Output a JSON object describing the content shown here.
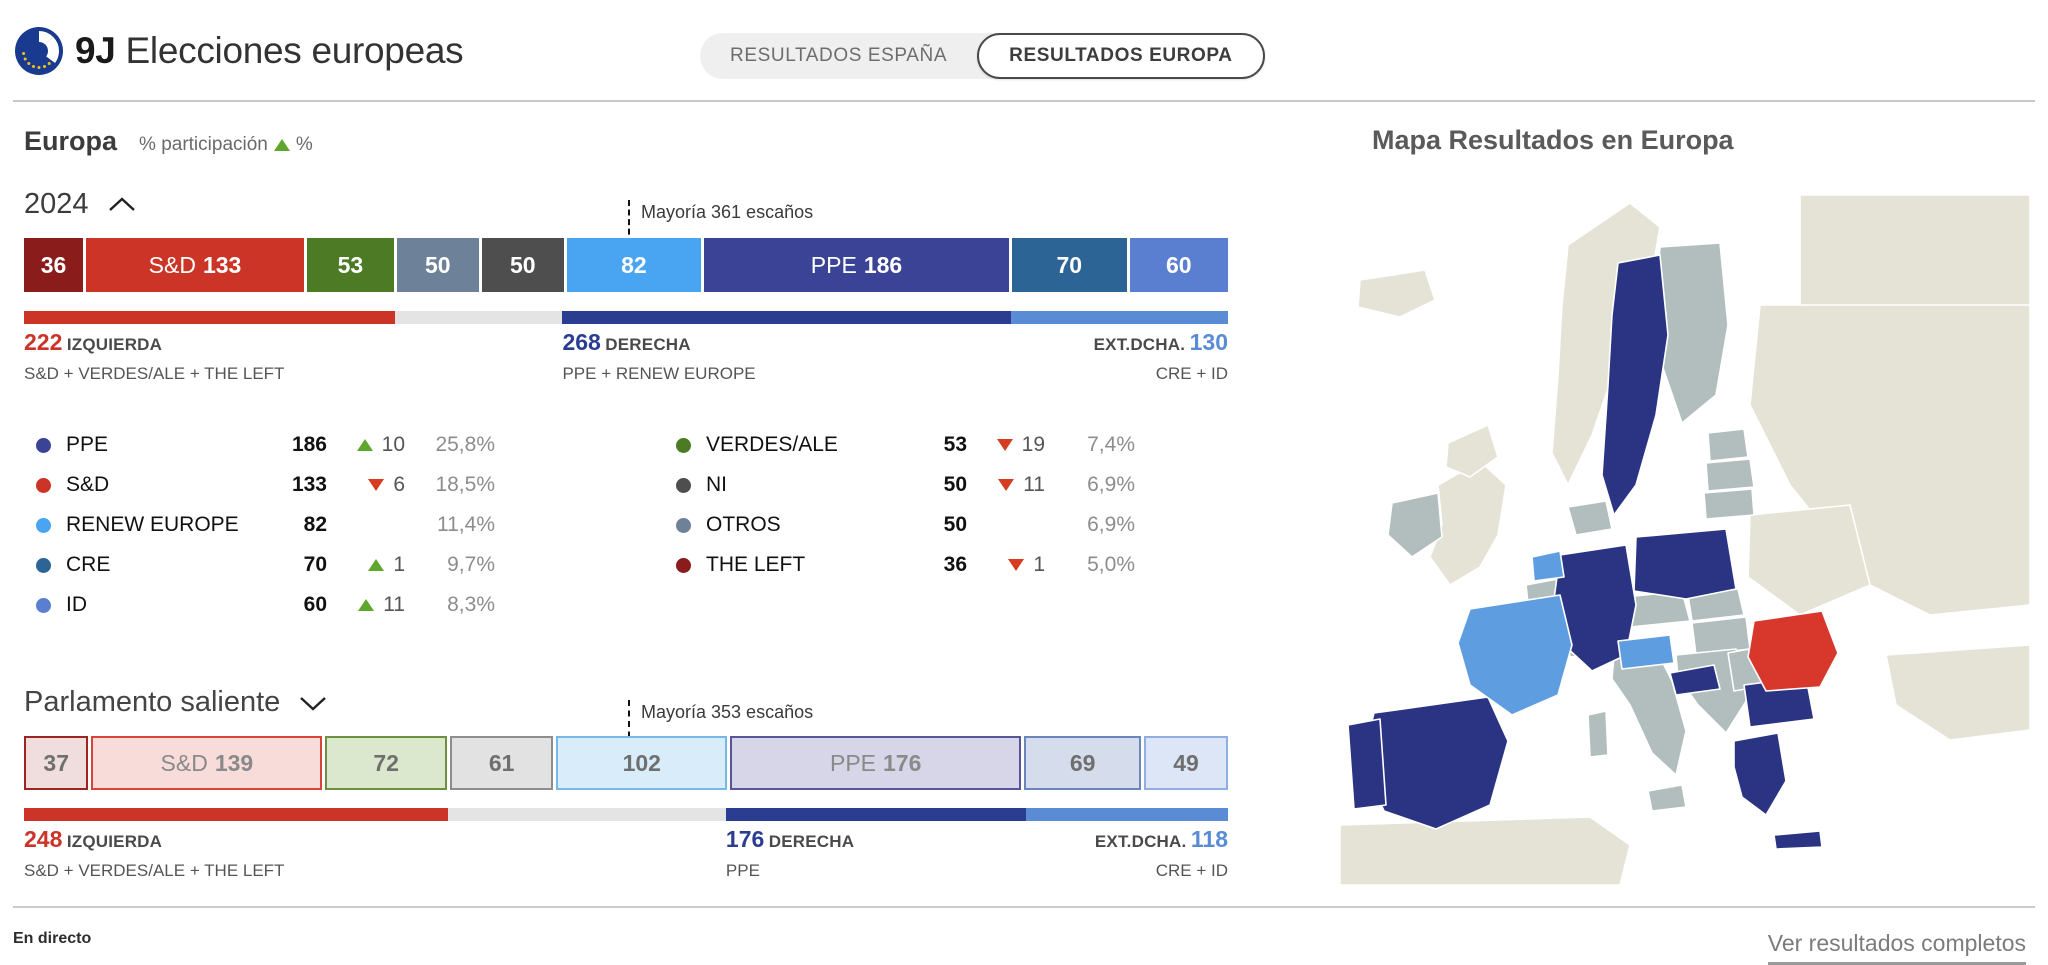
{
  "header": {
    "logo_icon": "eu-flag-icon",
    "title_bold": "9J",
    "title_rest": "Elecciones europeas",
    "toggle": {
      "spain_label": "RESULTADOS ESPAÑA",
      "europe_label": "RESULTADOS EUROPA",
      "active": "RESULTADOS EUROPA"
    }
  },
  "section": {
    "title": "Europa",
    "participacion": "% participación",
    "participacion_trend_icon": "triangle-up-icon",
    "participacion_value": "%"
  },
  "map": {
    "title": "Mapa Resultados en Europa"
  },
  "footer": {
    "live_label": "En directo",
    "see_all_label": "Ver resultados completos"
  },
  "colors": {
    "ppe": "#3a4395",
    "sd": "#cb3427",
    "renew": "#49a5f2",
    "cre": "#2c6496",
    "id": "#5a7fd0",
    "verdes": "#4d7a25",
    "ni": "#4e4e4e",
    "otros": "#6d8198",
    "left": "#8a1c1c",
    "izquierda": "#cb3427",
    "derecha": "#3a4395",
    "extdcha": "#5a8cd6",
    "up": "#5ea72c",
    "down": "#d43d21",
    "track": "#e4e4e4"
  },
  "chart_data": [
    {
      "type": "bar",
      "id": "resultados-2024",
      "title": "2024",
      "collapse_icon": "chevron-up-icon",
      "total_seats": 720,
      "majority_label": "Mayoría 361 escaños",
      "majority_seats": 361,
      "categories": [
        "THE LEFT",
        "S&D",
        "VERDES/ALE",
        "OTROS",
        "NI",
        "RENEW EUROPE",
        "PPE",
        "CRE",
        "ID"
      ],
      "values": [
        36,
        133,
        53,
        50,
        50,
        82,
        186,
        70,
        60
      ],
      "segments": [
        {
          "key": "left",
          "label": "",
          "value": "36",
          "color": "#8a1c1c",
          "text_color": "#ffffff"
        },
        {
          "key": "sd",
          "label": "S&D",
          "value": "133",
          "color": "#cb3427",
          "text_color": "#ffffff"
        },
        {
          "key": "verdes",
          "label": "",
          "value": "53",
          "color": "#4d7a25",
          "text_color": "#ffffff"
        },
        {
          "key": "otros",
          "label": "",
          "value": "50",
          "color": "#6d8198",
          "text_color": "#ffffff"
        },
        {
          "key": "ni",
          "label": "",
          "value": "50",
          "color": "#4e4e4e",
          "text_color": "#ffffff"
        },
        {
          "key": "renew",
          "label": "",
          "value": "82",
          "color": "#49a5f2",
          "text_color": "#ffffff"
        },
        {
          "key": "ppe",
          "label": "PPE",
          "value": "186",
          "color": "#3a4395",
          "text_color": "#ffffff"
        },
        {
          "key": "cre",
          "label": "",
          "value": "70",
          "color": "#2c6496",
          "text_color": "#ffffff"
        },
        {
          "key": "id",
          "label": "",
          "value": "60",
          "color": "#5a7fd0",
          "text_color": "#ffffff"
        }
      ],
      "blocs": [
        {
          "key": "izquierda",
          "value": "222",
          "caption": "IZQUIERDA",
          "sub": "S&D + VERDES/ALE + THE LEFT",
          "color": "#cb3427",
          "align": "left"
        },
        {
          "key": "derecha",
          "value": "268",
          "caption": "DERECHA",
          "sub": "PPE + RENEW EUROPE",
          "color": "#2b3d91",
          "align": "left"
        },
        {
          "key": "extdcha",
          "value": "130",
          "caption": "EXT.DCHA.",
          "sub": "CRE + ID",
          "color": "#5a8cd6",
          "align": "right"
        }
      ]
    },
    {
      "type": "bar",
      "id": "parlamento-saliente",
      "title": "Parlamento saliente",
      "collapse_icon": "chevron-down-icon",
      "total_seats": 705,
      "majority_label": "Mayoría 353 escaños",
      "majority_seats": 353,
      "categories": [
        "THE LEFT",
        "S&D",
        "VERDES/ALE",
        "NI",
        "RENEW EUROPE",
        "PPE",
        "CRE",
        "ID"
      ],
      "values": [
        37,
        139,
        72,
        61,
        102,
        176,
        69,
        49
      ],
      "segments": [
        {
          "key": "left",
          "label": "",
          "value": "37",
          "color": "#efdedd",
          "border": "#9c2523",
          "text_color": "#6f6f6f"
        },
        {
          "key": "sd",
          "label": "S&D",
          "value": "139",
          "color": "#f8dcda",
          "border": "#d8433a",
          "text_color": "#8a8a8a"
        },
        {
          "key": "verdes",
          "label": "",
          "value": "72",
          "color": "#dbe8cd",
          "border": "#6d8f42",
          "text_color": "#6f6f6f"
        },
        {
          "key": "ni",
          "label": "",
          "value": "61",
          "color": "#e2e2e2",
          "border": "#8d8d8d",
          "text_color": "#6f6f6f"
        },
        {
          "key": "renew",
          "label": "",
          "value": "102",
          "color": "#d9ecf9",
          "border": "#76b8e6",
          "text_color": "#6f6f6f"
        },
        {
          "key": "ppe",
          "label": "PPE",
          "value": "176",
          "color": "#d6d6e8",
          "border": "#59559b",
          "text_color": "#8a8a8a"
        },
        {
          "key": "cre",
          "label": "",
          "value": "69",
          "color": "#d5dcec",
          "border": "#6b86bd",
          "text_color": "#6f6f6f"
        },
        {
          "key": "id",
          "label": "",
          "value": "49",
          "color": "#dde6f6",
          "border": "#90aee0",
          "text_color": "#6f6f6f"
        }
      ],
      "blocs": [
        {
          "key": "izquierda",
          "value": "248",
          "caption": "IZQUIERDA",
          "sub": "S&D + VERDES/ALE + THE LEFT",
          "color": "#cb3427",
          "align": "left"
        },
        {
          "key": "derecha",
          "value": "176",
          "caption": "DERECHA",
          "sub": "PPE",
          "color": "#2b3d91",
          "align": "left"
        },
        {
          "key": "extdcha",
          "value": "118",
          "caption": "EXT.DCHA.",
          "sub": "CRE + ID",
          "color": "#5a8cd6",
          "align": "right"
        }
      ]
    }
  ],
  "legend": {
    "left_column": [
      {
        "name": "PPE",
        "seats": "186",
        "delta": "10",
        "trend": "up",
        "pct": "25,8%",
        "color": "#3a4395"
      },
      {
        "name": "S&D",
        "seats": "133",
        "delta": "6",
        "trend": "down",
        "pct": "18,5%",
        "color": "#cb3427"
      },
      {
        "name": "RENEW EUROPE",
        "seats": "82",
        "delta": "",
        "trend": "none",
        "pct": "11,4%",
        "color": "#49a5f2"
      },
      {
        "name": "CRE",
        "seats": "70",
        "delta": "1",
        "trend": "up",
        "pct": "9,7%",
        "color": "#2c6496"
      },
      {
        "name": "ID",
        "seats": "60",
        "delta": "11",
        "trend": "up",
        "pct": "8,3%",
        "color": "#5a7fd0"
      }
    ],
    "right_column": [
      {
        "name": "VERDES/ALE",
        "seats": "53",
        "delta": "19",
        "trend": "down",
        "pct": "7,4%",
        "color": "#4d7a25"
      },
      {
        "name": "NI",
        "seats": "50",
        "delta": "11",
        "trend": "down",
        "pct": "6,9%",
        "color": "#4e4e4e"
      },
      {
        "name": "OTROS",
        "seats": "50",
        "delta": "",
        "trend": "none",
        "pct": "6,9%",
        "color": "#6d8198"
      },
      {
        "name": "THE LEFT",
        "seats": "36",
        "delta": "1",
        "trend": "down",
        "pct": "5,0%",
        "color": "#8a1c1c"
      }
    ]
  }
}
